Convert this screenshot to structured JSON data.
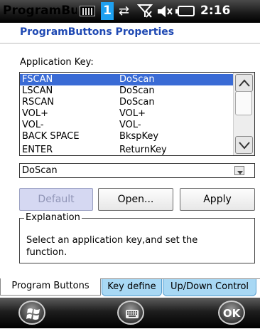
{
  "status": {
    "app_title": "ProgramButto",
    "notification_count": "1",
    "time": "2:16"
  },
  "header": {
    "title": "ProgramButtons Properties"
  },
  "form": {
    "app_key_label": "Application Key:",
    "list_rows": [
      {
        "key": "FSCAN",
        "func": "DoScan",
        "selected": true
      },
      {
        "key": "LSCAN",
        "func": "DoScan"
      },
      {
        "key": "RSCAN",
        "func": "DoScan"
      },
      {
        "key": "VOL+",
        "func": "VOL+"
      },
      {
        "key": "VOL-",
        "func": "VOL-"
      },
      {
        "key": "BACK SPACE",
        "func": "BkspKey"
      },
      {
        "key": "ENTER",
        "func": "ReturnKey"
      }
    ],
    "combo_value": "DoScan",
    "buttons": {
      "default": "Default",
      "open": "Open...",
      "apply": "Apply"
    },
    "explanation_title": "Explanation",
    "explanation_text": "Select an application key,and set the function."
  },
  "tabs": [
    "Program Buttons",
    "Key define",
    "Up/Down Control"
  ],
  "bottom_bar": {
    "ok_label": "OK"
  },
  "colors": {
    "title_blue": "#1f49b3",
    "selection_blue": "#3a6bd5",
    "tab_blue": "#a8d8f4"
  }
}
